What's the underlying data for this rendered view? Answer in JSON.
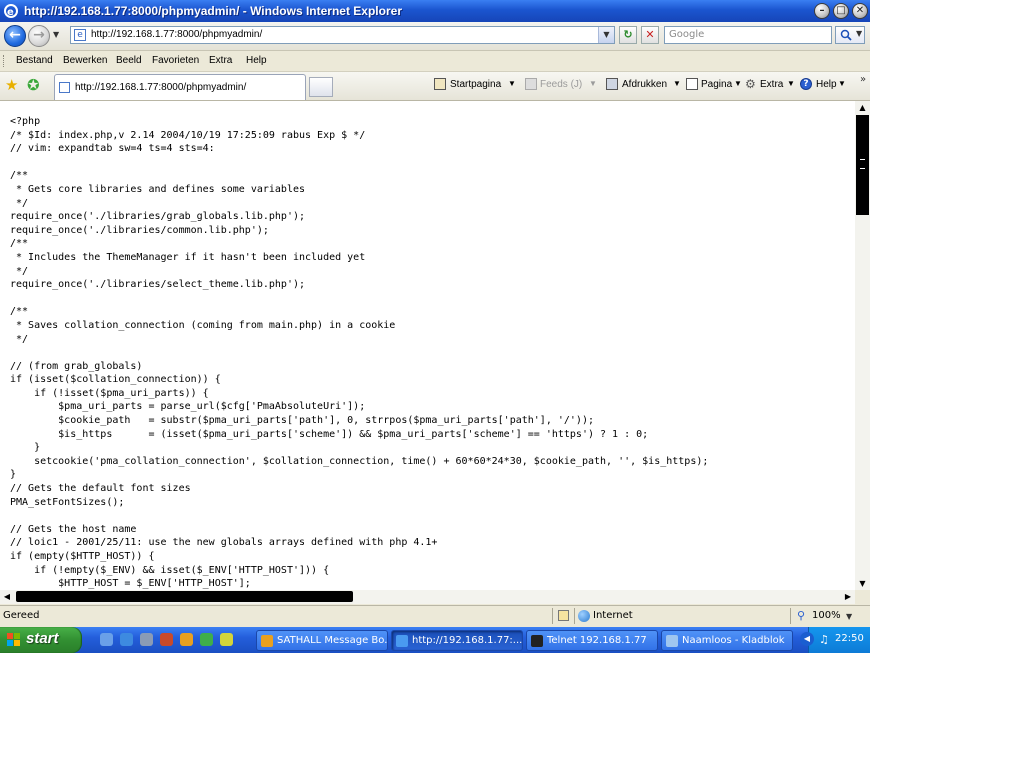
{
  "window": {
    "title": "http://192.168.1.77:8000/phpmyadmin/ - Windows Internet Explorer",
    "minimize_glyph": "–",
    "maximize_glyph": "□",
    "close_glyph": "✕"
  },
  "address_bar": {
    "url": "http://192.168.1.77:8000/phpmyadmin/",
    "search_placeholder": "Google"
  },
  "menu": {
    "items": [
      "Bestand",
      "Bewerken",
      "Beeld",
      "Favorieten",
      "Extra",
      "Help"
    ]
  },
  "tabs": {
    "active_label": "http://192.168.1.77:8000/phpmyadmin/"
  },
  "command_bar": {
    "home": "Startpagina",
    "feeds": "Feeds (J)",
    "print": "Afdrukken",
    "page": "Pagina",
    "tools": "Extra",
    "help": "Help"
  },
  "content": {
    "code": "<?php\n/* $Id: index.php,v 2.14 2004/10/19 17:25:09 rabus Exp $ */\n// vim: expandtab sw=4 ts=4 sts=4:\n\n/**\n * Gets core libraries and defines some variables\n */\nrequire_once('./libraries/grab_globals.lib.php');\nrequire_once('./libraries/common.lib.php');\n/**\n * Includes the ThemeManager if it hasn't been included yet\n */\nrequire_once('./libraries/select_theme.lib.php');\n\n/**\n * Saves collation_connection (coming from main.php) in a cookie\n */\n\n// (from grab_globals)\nif (isset($collation_connection)) {\n    if (!isset($pma_uri_parts)) {\n        $pma_uri_parts = parse_url($cfg['PmaAbsoluteUri']);\n        $cookie_path   = substr($pma_uri_parts['path'], 0, strrpos($pma_uri_parts['path'], '/'));\n        $is_https      = (isset($pma_uri_parts['scheme']) && $pma_uri_parts['scheme'] == 'https') ? 1 : 0;\n    }\n    setcookie('pma_collation_connection', $collation_connection, time() + 60*60*24*30, $cookie_path, '', $is_https);\n}\n// Gets the default font sizes\nPMA_setFontSizes();\n\n// Gets the host name\n// loic1 - 2001/25/11: use the new globals arrays defined with php 4.1+\nif (empty($HTTP_HOST)) {\n    if (!empty($_ENV) && isset($_ENV['HTTP_HOST'])) {\n        $HTTP_HOST = $_ENV['HTTP_HOST'];"
  },
  "status_bar": {
    "text": "Gereed",
    "zone": "Internet",
    "zoom": "100%"
  },
  "taskbar": {
    "start_label": "start",
    "buttons": [
      {
        "label": "SATHALL Message Bo..."
      },
      {
        "label": "http://192.168.1.77:..."
      },
      {
        "label": "Telnet 192.168.1.77"
      },
      {
        "label": "Naamloos - Kladblok"
      }
    ],
    "clock": "22:50"
  }
}
